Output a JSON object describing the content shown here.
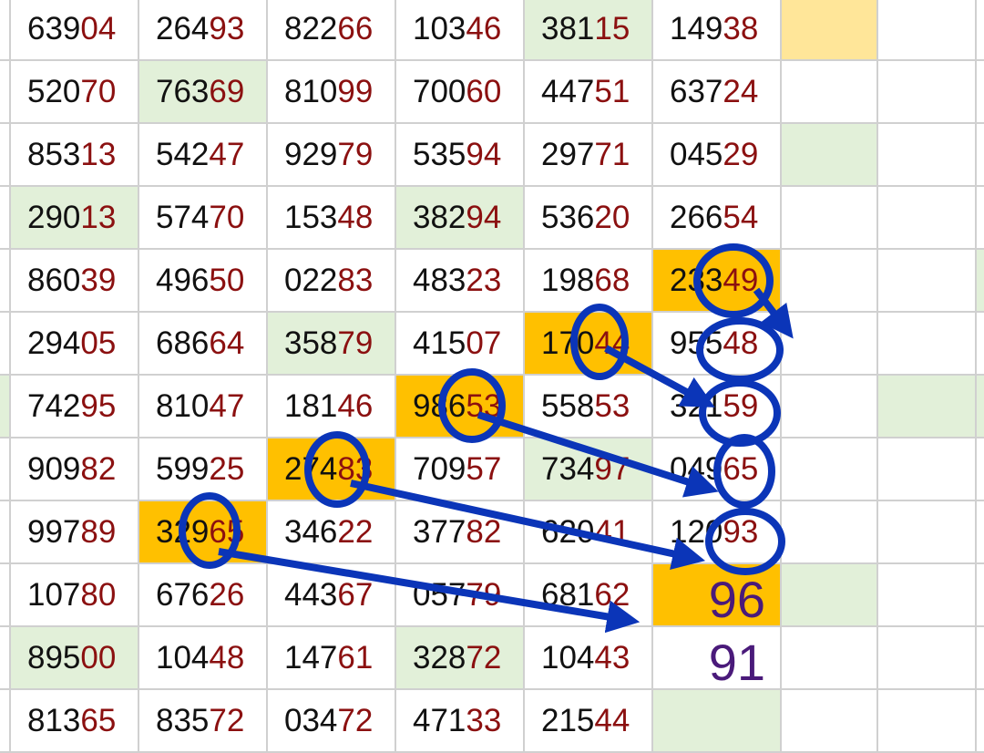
{
  "rows": [
    [
      {
        "a": "639",
        "b": "04"
      },
      {
        "a": "264",
        "b": "93"
      },
      {
        "a": "822",
        "b": "66"
      },
      {
        "a": "103",
        "b": "46"
      },
      {
        "a": "381",
        "b": "15",
        "bg": "green"
      },
      {
        "a": "149",
        "b": "38"
      }
    ],
    [
      {
        "a": "520",
        "b": "70"
      },
      {
        "a": "763",
        "b": "69",
        "bg": "green"
      },
      {
        "a": "810",
        "b": "99"
      },
      {
        "a": "700",
        "b": "60"
      },
      {
        "a": "447",
        "b": "51"
      },
      {
        "a": "637",
        "b": "24"
      }
    ],
    [
      {
        "a": "853",
        "b": "13"
      },
      {
        "a": "542",
        "b": "47"
      },
      {
        "a": "929",
        "b": "79"
      },
      {
        "a": "535",
        "b": "94"
      },
      {
        "a": "297",
        "b": "71"
      },
      {
        "a": "045",
        "b": "29"
      }
    ],
    [
      {
        "a": "290",
        "b": "13",
        "bg": "green"
      },
      {
        "a": "574",
        "b": "70"
      },
      {
        "a": "153",
        "b": "48"
      },
      {
        "a": "382",
        "b": "94",
        "bg": "green"
      },
      {
        "a": "536",
        "b": "20"
      },
      {
        "a": "266",
        "b": "54"
      }
    ],
    [
      {
        "a": "860",
        "b": "39"
      },
      {
        "a": "496",
        "b": "50"
      },
      {
        "a": "022",
        "b": "83"
      },
      {
        "a": "483",
        "b": "23"
      },
      {
        "a": "198",
        "b": "68"
      },
      {
        "a": "233",
        "b": "49",
        "bg": "orange"
      }
    ],
    [
      {
        "a": "294",
        "b": "05"
      },
      {
        "a": "686",
        "b": "64"
      },
      {
        "a": "358",
        "b": "79",
        "bg": "green"
      },
      {
        "a": "415",
        "b": "07"
      },
      {
        "a": "170",
        "b": "44",
        "bg": "orange"
      },
      {
        "a": "955",
        "b": "48"
      }
    ],
    [
      {
        "a": "742",
        "b": "95"
      },
      {
        "a": "810",
        "b": "47"
      },
      {
        "a": "181",
        "b": "46"
      },
      {
        "a": "986",
        "b": "53",
        "bg": "orange"
      },
      {
        "a": "558",
        "b": "53"
      },
      {
        "a": "321",
        "b": "59"
      }
    ],
    [
      {
        "a": "909",
        "b": "82"
      },
      {
        "a": "599",
        "b": "25"
      },
      {
        "a": "274",
        "b": "83",
        "bg": "orange"
      },
      {
        "a": "709",
        "b": "57"
      },
      {
        "a": "734",
        "b": "97",
        "bg": "green"
      },
      {
        "a": "049",
        "b": "65"
      }
    ],
    [
      {
        "a": "997",
        "b": "89"
      },
      {
        "a": "329",
        "b": "65",
        "bg": "orange"
      },
      {
        "a": "346",
        "b": "22"
      },
      {
        "a": "377",
        "b": "82"
      },
      {
        "a": "620",
        "b": "41"
      },
      {
        "a": "120",
        "b": "93"
      }
    ],
    [
      {
        "a": "107",
        "b": "80"
      },
      {
        "a": "676",
        "b": "26"
      },
      {
        "a": "443",
        "b": "67"
      },
      {
        "a": "057",
        "b": "79"
      },
      {
        "a": "681",
        "b": "62"
      },
      {
        "note": "96",
        "bg": "orange"
      }
    ],
    [
      {
        "a": "895",
        "b": "00",
        "bg": "green"
      },
      {
        "a": "104",
        "b": "48"
      },
      {
        "a": "147",
        "b": "61"
      },
      {
        "a": "328",
        "b": "72",
        "bg": "green"
      },
      {
        "a": "104",
        "b": "43"
      },
      {
        "note": "91"
      }
    ],
    [
      {
        "a": "813",
        "b": "65"
      },
      {
        "a": "835",
        "b": "72"
      },
      {
        "a": "034",
        "b": "72"
      },
      {
        "a": "471",
        "b": "33"
      },
      {
        "a": "215",
        "b": "44"
      },
      {
        "bg": "green"
      }
    ]
  ],
  "extra_column": [
    "yellow",
    "",
    "green",
    "",
    "",
    "",
    "",
    "",
    "",
    "green",
    "",
    ""
  ],
  "edge_column": [
    "",
    "",
    "",
    "",
    "green",
    "",
    "green",
    "",
    "",
    "",
    "",
    ""
  ],
  "colors": {
    "green": "#e2f0d9",
    "orange": "#ffc000",
    "yellow": "#ffe699",
    "grid_line": "#d0d0d0",
    "digit_red": "#8b1010",
    "annotation_blue": "#0b35b8",
    "note_purple": "#4a1a7a"
  }
}
